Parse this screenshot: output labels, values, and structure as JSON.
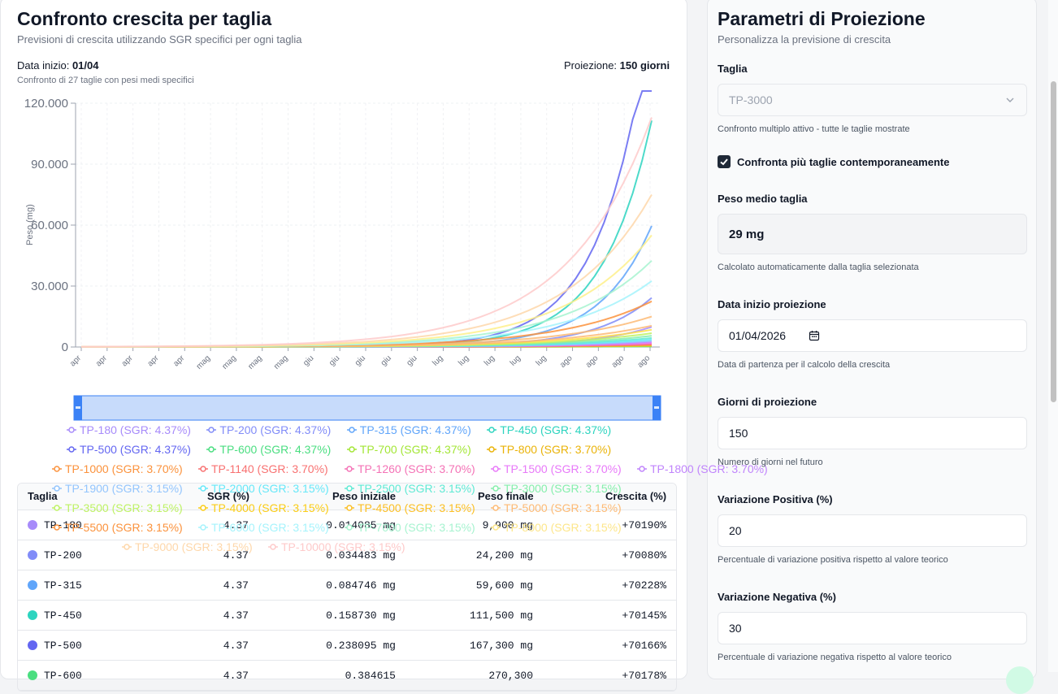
{
  "left": {
    "title": "Confronto crescita per taglia",
    "subtitle": "Previsioni di crescita utilizzando SGR specifici per ogni taglia",
    "start_label": "Data inizio:",
    "start_value": "01/04",
    "projection_label": "Proiezione:",
    "projection_value": "150 giorni",
    "compare_note": "Confronto di 27 taglie con pesi medi specifici"
  },
  "chart_data": {
    "type": "line",
    "ylabel": "Peso (mg)",
    "ylim": [
      0,
      120000
    ],
    "y_ticks": [
      "120.000",
      "90.000",
      "60.000",
      "30.000",
      "0"
    ],
    "x_ticks": [
      "apr",
      "apr",
      "apr",
      "apr",
      "apr",
      "mag",
      "mag",
      "mag",
      "mag",
      "giu",
      "giu",
      "giu",
      "giu",
      "giu",
      "lug",
      "lug",
      "lug",
      "lug",
      "lug",
      "ago",
      "ago",
      "ago",
      "ago"
    ],
    "grid": true,
    "days": 150,
    "series": [
      {
        "name": "TP-180",
        "sgr": "4.37",
        "color": "#a78bfa",
        "start": 0.014085,
        "end": 9900
      },
      {
        "name": "TP-200",
        "sgr": "4.37",
        "color": "#818cf8",
        "start": 0.034483,
        "end": 24200
      },
      {
        "name": "TP-315",
        "sgr": "4.37",
        "color": "#60a5fa",
        "start": 0.084746,
        "end": 59600
      },
      {
        "name": "TP-450",
        "sgr": "4.37",
        "color": "#2dd4bf",
        "start": 0.15873,
        "end": 111500
      },
      {
        "name": "TP-500",
        "sgr": "4.37",
        "color": "#6366f1",
        "start": 0.238095,
        "end": 167300
      },
      {
        "name": "TP-600",
        "sgr": "4.37",
        "color": "#4ade80",
        "start": 0.5,
        "end": 300
      },
      {
        "name": "TP-700",
        "sgr": "4.37",
        "color": "#a3e635",
        "start": 0.8,
        "end": 500
      },
      {
        "name": "TP-800",
        "sgr": "3.70",
        "color": "#facc15",
        "start": 1.2,
        "end": 700
      },
      {
        "name": "TP-1000",
        "sgr": "3.70",
        "color": "#fb923c",
        "start": 1.8,
        "end": 1000
      },
      {
        "name": "TP-1140",
        "sgr": "3.70",
        "color": "#f87171",
        "start": 2.5,
        "end": 1300
      },
      {
        "name": "TP-1260",
        "sgr": "3.70",
        "color": "#f472b6",
        "start": 3.2,
        "end": 1700
      },
      {
        "name": "TP-1500",
        "sgr": "3.70",
        "color": "#e879f9",
        "start": 4.0,
        "end": 2100
      },
      {
        "name": "TP-1800",
        "sgr": "3.70",
        "color": "#c084fc",
        "start": 5.0,
        "end": 2600
      },
      {
        "name": "TP-1900",
        "sgr": "3.15",
        "color": "#93c5fd",
        "start": 7.0,
        "end": 3000
      },
      {
        "name": "TP-2000",
        "sgr": "3.15",
        "color": "#67e8f9",
        "start": 9.0,
        "end": 3600
      },
      {
        "name": "TP-2500",
        "sgr": "3.15",
        "color": "#5eead4",
        "start": 12.0,
        "end": 4400
      },
      {
        "name": "TP-3000",
        "sgr": "3.15",
        "color": "#86efac",
        "start": 15.0,
        "end": 5500
      },
      {
        "name": "TP-3500",
        "sgr": "3.15",
        "color": "#bef264",
        "start": 19.0,
        "end": 6800
      },
      {
        "name": "TP-4000",
        "sgr": "3.15",
        "color": "#fde047",
        "start": 24.0,
        "end": 8500
      },
      {
        "name": "TP-4500",
        "sgr": "3.15",
        "color": "#fdba74",
        "start": 29.0,
        "end": 10500
      },
      {
        "name": "TP-5000",
        "sgr": "3.15",
        "color": "#fdba74",
        "start": 36.0,
        "end": 15000
      },
      {
        "name": "TP-5500",
        "sgr": "3.15",
        "color": "#fb923c",
        "start": 44.0,
        "end": 22500
      },
      {
        "name": "TP-6000",
        "sgr": "3.15",
        "color": "#a5f3fc",
        "start": 54.0,
        "end": 32500
      },
      {
        "name": "TP-7000",
        "sgr": "3.15",
        "color": "#a7f3d0",
        "start": 66.0,
        "end": 42500
      },
      {
        "name": "TP-8000",
        "sgr": "3.15",
        "color": "#fef08a",
        "start": 80.0,
        "end": 55000
      },
      {
        "name": "TP-9000",
        "sgr": "3.15",
        "color": "#fed7aa",
        "start": 100.0,
        "end": 75000
      },
      {
        "name": "TP-10000",
        "sgr": "3.15",
        "color": "#fecaca",
        "start": 130.0,
        "end": 113000
      }
    ]
  },
  "legend": [
    {
      "text": "TP-180 (SGR: 4.37%)",
      "color": "#a78bfa"
    },
    {
      "text": "TP-200 (SGR: 4.37%)",
      "color": "#818cf8"
    },
    {
      "text": "TP-315 (SGR: 4.37%)",
      "color": "#60a5fa"
    },
    {
      "text": "TP-450 (SGR: 4.37%)",
      "color": "#2dd4bf"
    },
    {
      "text": "TP-500 (SGR: 4.37%)",
      "color": "#6366f1"
    },
    {
      "text": "TP-600 (SGR: 4.37%)",
      "color": "#4ade80"
    },
    {
      "text": "TP-700 (SGR: 4.37%)",
      "color": "#a3e635"
    },
    {
      "text": "TP-800 (SGR: 3.70%)",
      "color": "#eab308"
    },
    {
      "text": "TP-1000 (SGR: 3.70%)",
      "color": "#fb923c"
    },
    {
      "text": "TP-1140 (SGR: 3.70%)",
      "color": "#f87171"
    },
    {
      "text": "TP-1260 (SGR: 3.70%)",
      "color": "#f472b6"
    },
    {
      "text": "TP-1500 (SGR: 3.70%)",
      "color": "#e879f9"
    },
    {
      "text": "TP-1800 (SGR: 3.70%)",
      "color": "#c084fc"
    },
    {
      "text": "TP-1900 (SGR: 3.15%)",
      "color": "#93c5fd"
    },
    {
      "text": "TP-2000 (SGR: 3.15%)",
      "color": "#67e8f9"
    },
    {
      "text": "TP-2500 (SGR: 3.15%)",
      "color": "#5eead4"
    },
    {
      "text": "TP-3000 (SGR: 3.15%)",
      "color": "#86efac"
    },
    {
      "text": "TP-3500 (SGR: 3.15%)",
      "color": "#bef264"
    },
    {
      "text": "TP-4000 (SGR: 3.15%)",
      "color": "#facc15"
    },
    {
      "text": "TP-4500 (SGR: 3.15%)",
      "color": "#fbbf24"
    },
    {
      "text": "TP-5000 (SGR: 3.15%)",
      "color": "#fdba74"
    },
    {
      "text": "TP-5500 (SGR: 3.15%)",
      "color": "#fb923c"
    },
    {
      "text": "TP-6000 (SGR: 3.15%)",
      "color": "#a5f3fc"
    },
    {
      "text": "TP-7000 (SGR: 3.15%)",
      "color": "#a7f3d0"
    },
    {
      "text": "TP-8000 (SGR: 3.15%)",
      "color": "#fde68a"
    },
    {
      "text": "TP-9000 (SGR: 3.15%)",
      "color": "#fed7aa"
    },
    {
      "text": "TP-10000 (SGR: 3.15%)",
      "color": "#fecaca"
    }
  ],
  "table": {
    "headers": [
      "Taglia",
      "SGR (%)",
      "Peso iniziale",
      "Peso finale",
      "Crescita (%)"
    ],
    "rows": [
      {
        "taglia": "TP-180",
        "sgr": "4.37",
        "initial": "0.014085 mg",
        "final": "9,900 mg",
        "growth": "+70190%",
        "color": "#a78bfa"
      },
      {
        "taglia": "TP-200",
        "sgr": "4.37",
        "initial": "0.034483 mg",
        "final": "24,200 mg",
        "growth": "+70080%",
        "color": "#818cf8"
      },
      {
        "taglia": "TP-315",
        "sgr": "4.37",
        "initial": "0.084746 mg",
        "final": "59,600 mg",
        "growth": "+70228%",
        "color": "#60a5fa"
      },
      {
        "taglia": "TP-450",
        "sgr": "4.37",
        "initial": "0.158730 mg",
        "final": "111,500 mg",
        "growth": "+70145%",
        "color": "#2dd4bf"
      },
      {
        "taglia": "TP-500",
        "sgr": "4.37",
        "initial": "0.238095 mg",
        "final": "167,300 mg",
        "growth": "+70166%",
        "color": "#6366f1"
      },
      {
        "taglia": "TP-600",
        "sgr": "4.37",
        "initial": "0.384615",
        "final": "270,300",
        "growth": "+70178%",
        "color": "#4ade80"
      }
    ]
  },
  "right": {
    "title": "Parametri di Proiezione",
    "subtitle": "Personalizza la previsione di crescita",
    "size_label": "Taglia",
    "size_value": "TP-3000",
    "size_help": "Confronto multiplo attivo - tutte le taglie mostrate",
    "compare_label": "Confronta più taglie contemporaneamente",
    "weight_label": "Peso medio taglia",
    "weight_value": "29 mg",
    "weight_help": "Calcolato automaticamente dalla taglia selezionata",
    "date_label": "Data inizio proiezione",
    "date_value": "01/04/2026",
    "date_help": "Data di partenza per il calcolo della crescita",
    "days_label": "Giorni di proiezione",
    "days_value": "150",
    "days_help": "Numero di giorni nel futuro",
    "pos_label": "Variazione Positiva (%)",
    "pos_value": "20",
    "pos_help": "Percentuale di variazione positiva rispetto al valore teorico",
    "neg_label": "Variazione Negativa (%)",
    "neg_value": "30",
    "neg_help": "Percentuale di variazione negativa rispetto al valore teorico"
  }
}
